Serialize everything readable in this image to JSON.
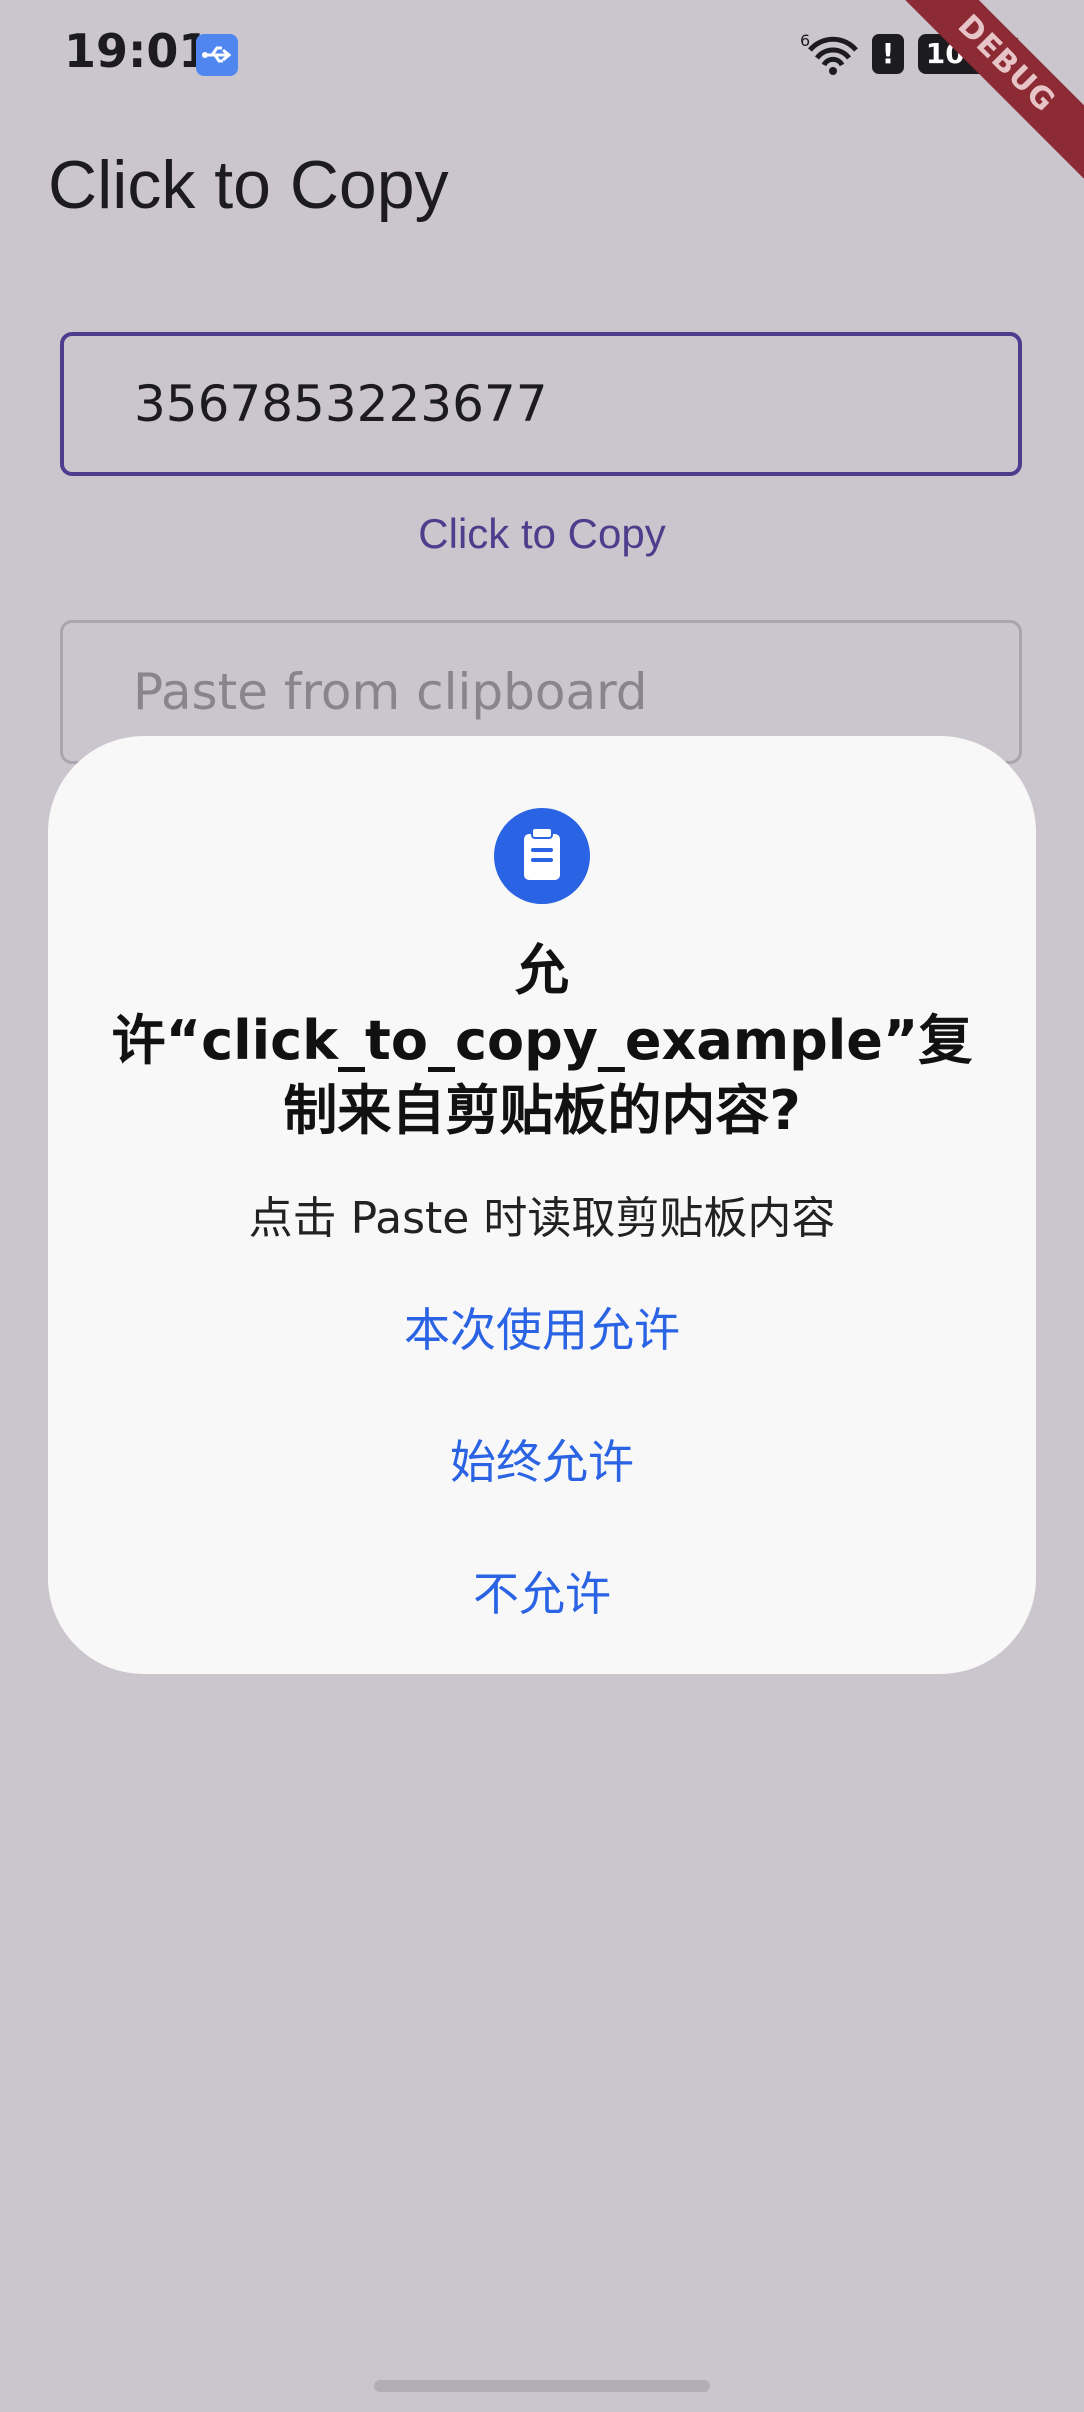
{
  "status_bar": {
    "time": "19:01",
    "alert_glyph": "!",
    "battery": "100",
    "debug_banner": "DEBUG"
  },
  "app": {
    "title": "Click to Copy",
    "copy_field_value": "3567853223677",
    "copy_button_label": "Click to Copy",
    "paste_placeholder": "Paste from clipboard"
  },
  "dialog": {
    "title": "允许“click_to_copy_example”复制来自剪贴板的内容?",
    "subtitle": "点击 Paste 时读取剪贴板内容",
    "buttons": {
      "allow_once": "本次使用允许",
      "always_allow": "始终允许",
      "deny": "不允许"
    }
  },
  "colors": {
    "background": "#cbc6cd",
    "accent": "#4c3e8c",
    "dialog_accent": "#2a63e4",
    "debug_banner": "#8d2b35"
  }
}
